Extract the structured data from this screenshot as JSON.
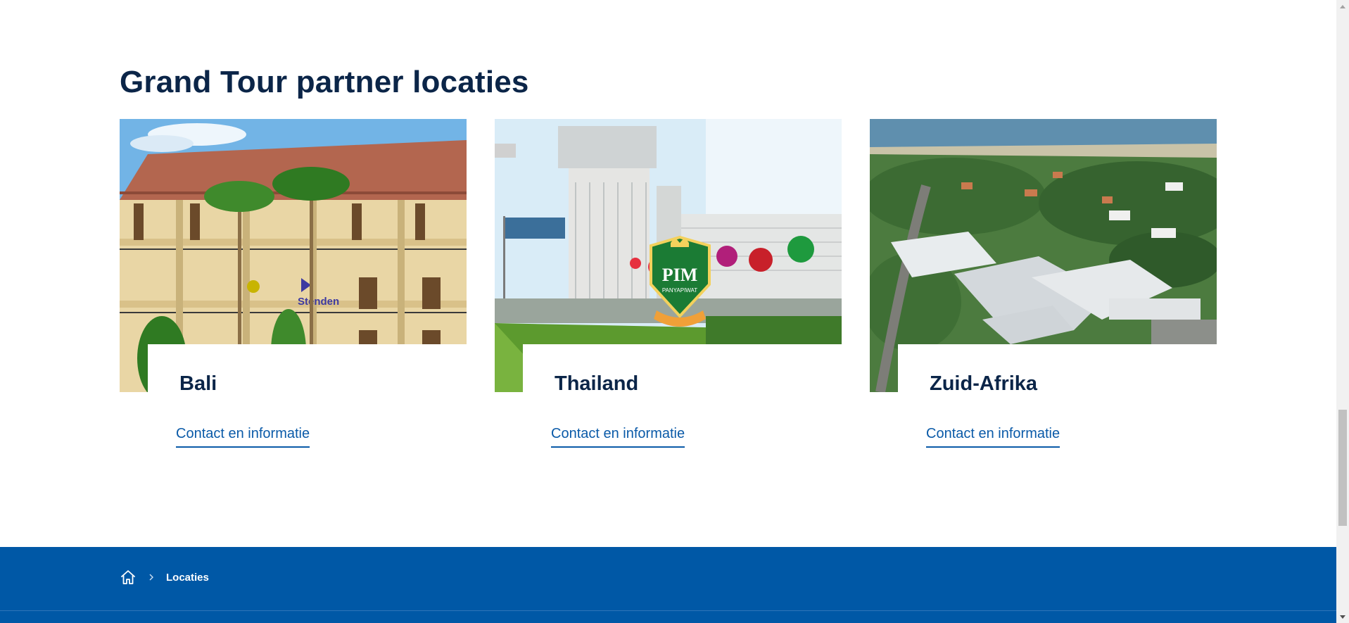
{
  "section": {
    "title": "Grand Tour partner locaties"
  },
  "cards": [
    {
      "name": "Bali",
      "link_label": "Contact en informatie",
      "image_icon": "bali-school-building-photo"
    },
    {
      "name": "Thailand",
      "link_label": "Contact en informatie",
      "image_icon": "thailand-pim-campus-photo"
    },
    {
      "name": "Zuid-Afrika",
      "link_label": "Contact en informatie",
      "image_icon": "south-africa-coastal-campus-photo"
    }
  ],
  "photo_text": {
    "bali_sign": "Stenden",
    "pim_logo": "PIM",
    "pim_ribbon": "PANYAPIWAT"
  },
  "breadcrumb": {
    "home_icon": "home-icon",
    "separator": "›",
    "current": "Locaties"
  },
  "colors": {
    "heading": "#0b2548",
    "link": "#0a5aa8",
    "footer": "#0058a6",
    "page_bg": "#ffffff"
  }
}
